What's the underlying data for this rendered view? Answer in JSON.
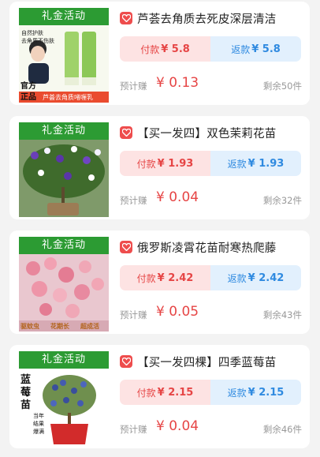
{
  "products": [
    {
      "banner": "礼金活动",
      "title": "芦荟去角质去死皮深层清洁",
      "pay_label": "付款",
      "pay_amount": "¥ 5.8",
      "refund_label": "返款",
      "refund_amount": "¥ 5.8",
      "est_label": "预计赚",
      "est_value": "¥ 0.13",
      "stock": "剩余50件",
      "image_texts": [
        "自然护肤",
        "去角质不伤肤",
        "官方",
        "正品",
        "芦荟去角质啫喱乳"
      ]
    },
    {
      "banner": "礼金活动",
      "title": "【买一发四】双色茉莉花苗",
      "pay_label": "付款",
      "pay_amount": "¥ 1.93",
      "refund_label": "返款",
      "refund_amount": "¥ 1.93",
      "est_label": "预计赚",
      "est_value": "¥ 0.04",
      "stock": "剩余32件",
      "image_texts": []
    },
    {
      "banner": "礼金活动",
      "title": "俄罗斯凌霄花苗耐寒热爬藤",
      "pay_label": "付款",
      "pay_amount": "¥ 2.42",
      "refund_label": "返款",
      "refund_amount": "¥ 2.42",
      "est_label": "预计赚",
      "est_value": "¥ 0.05",
      "stock": "剩余43件",
      "image_texts": [
        "驱蚊虫",
        "花期长",
        "超成活"
      ]
    },
    {
      "banner": "礼金活动",
      "title": "【买一发四棵】四季蓝莓苗",
      "pay_label": "付款",
      "pay_amount": "¥ 2.15",
      "refund_label": "返款",
      "refund_amount": "¥ 2.15",
      "est_label": "预计赚",
      "est_value": "¥ 0.04",
      "stock": "剩余46件",
      "image_texts": [
        "蓝",
        "莓",
        "苗",
        "当年",
        "结果",
        "爆满"
      ]
    }
  ],
  "colors": {
    "banner_green": "#2c9b33",
    "pay_text": "#e64545",
    "pay_bg": "#fde3e3",
    "refund_text": "#2f8ae0",
    "refund_bg": "#e2f0fd",
    "heart_badge": "#ee4d4d"
  },
  "icons": {
    "badge": "heart-icon"
  }
}
